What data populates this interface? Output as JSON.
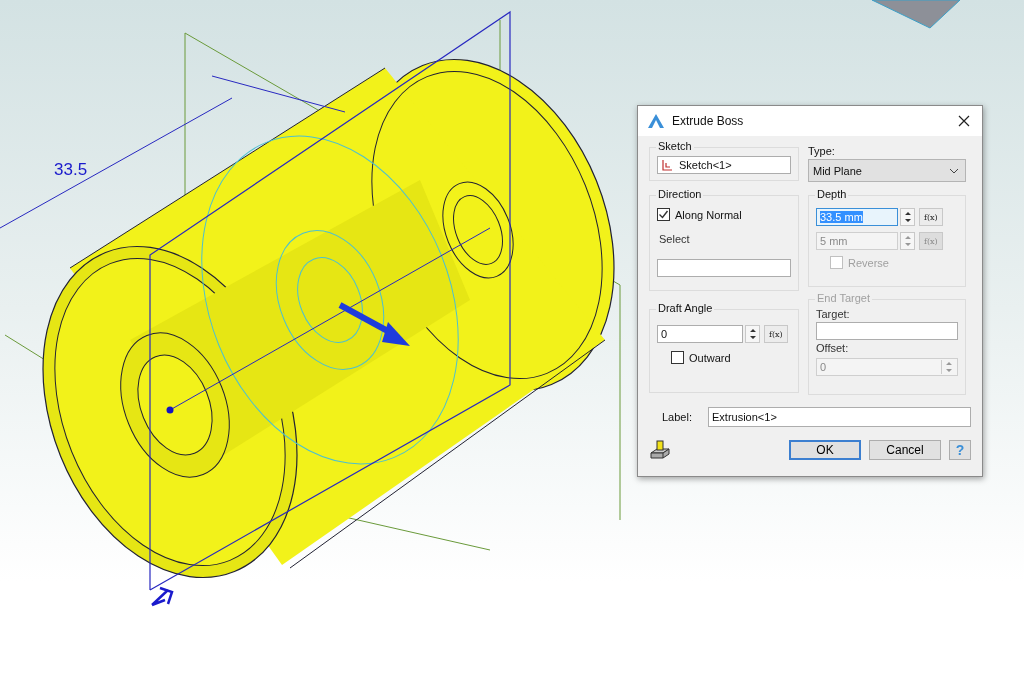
{
  "viewport": {
    "dimension_label": "33.5"
  },
  "dialog": {
    "title": "Extrude Boss",
    "sketch": {
      "legend": "Sketch",
      "value": "Sketch<1>"
    },
    "direction": {
      "legend": "Direction",
      "along_normal": {
        "label": "Along Normal",
        "checked": true
      },
      "select_label": "Select"
    },
    "draft_angle": {
      "legend": "Draft Angle",
      "value": "0",
      "fx": "f(x)",
      "outward": {
        "label": "Outward",
        "checked": false
      }
    },
    "type": {
      "label": "Type:",
      "value": "Mid Plane"
    },
    "depth": {
      "legend": "Depth",
      "value": "33.5 mm",
      "highlighted": true,
      "fx": "f(x)",
      "second_value": "5 mm",
      "second_fx": "f(x)",
      "second_disabled": true,
      "reverse": {
        "label": "Reverse",
        "checked": false,
        "disabled": true
      }
    },
    "end_target": {
      "legend": "End Target",
      "disabled": true,
      "target_label": "Target:",
      "offset_label": "Offset:",
      "offset_value": "0"
    },
    "label": {
      "label": "Label:",
      "value": "Extrusion<1>"
    },
    "buttons": [
      {
        "label": "OK",
        "default": true
      },
      {
        "label": "Cancel",
        "default": false
      }
    ],
    "help": "?"
  }
}
